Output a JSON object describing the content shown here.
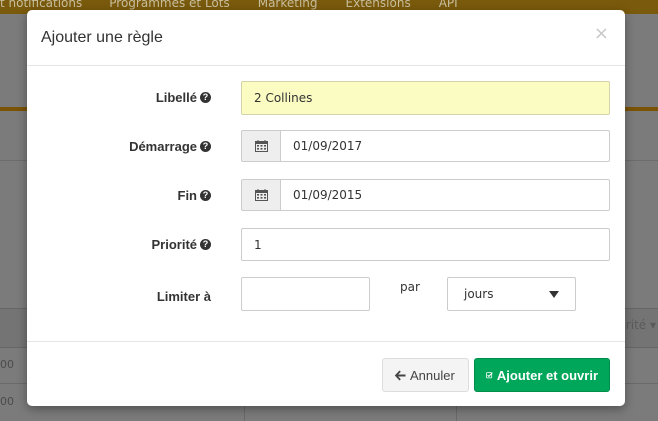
{
  "background": {
    "nav_items": [
      "t notifications",
      "Programmes et Lots",
      "Marketing",
      "Extensions",
      "API"
    ],
    "table_column_right": "rité ▾",
    "row_values": [
      "00",
      "00"
    ]
  },
  "modal": {
    "title": "Ajouter une règle",
    "close_symbol": "×",
    "fields": {
      "libelle": {
        "label": "Libellé",
        "value": "2 Collines"
      },
      "demarrage": {
        "label": "Démarrage",
        "value": "01/09/2017"
      },
      "fin": {
        "label": "Fin",
        "value": "01/09/2015"
      },
      "priorite": {
        "label": "Priorité",
        "value": "1"
      },
      "limiter": {
        "label": "Limiter à",
        "value": "",
        "par_label": "par",
        "unit_selected": "jours"
      }
    },
    "help_icon_glyph": "?",
    "buttons": {
      "cancel_label": "Annuler",
      "submit_label": "Ajouter et ouvrir"
    }
  },
  "icons": [
    "question-circle-icon",
    "calendar-icon",
    "arrow-left-icon",
    "check-square-icon",
    "close-icon",
    "caret-down-icon"
  ],
  "colors": {
    "primary_button": "#00a65a",
    "highlight_input": "#fafcc2",
    "overlay": "#7b7b7b"
  }
}
